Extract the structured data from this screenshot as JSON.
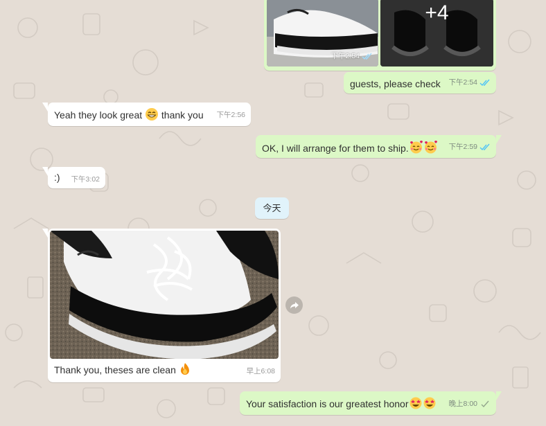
{
  "colors": {
    "outgoing_bubble": "#dcf8c6",
    "incoming_bubble": "#ffffff",
    "wallpaper": "#e5ddd5",
    "date_chip": "#e1f3fb",
    "read_ticks": "#4fc3f7"
  },
  "album": {
    "more_count_label": "+4",
    "time": "下午2:54"
  },
  "messages": [
    {
      "direction": "out",
      "text": "guests, please check",
      "time": "下午2:54",
      "ticks": "read"
    },
    {
      "direction": "in",
      "text": "Yeah they look great",
      "emoji": "beaming-face-emoji",
      "text_after": "thank you",
      "time": "下午2:56"
    },
    {
      "direction": "out",
      "text": "OK, I will arrange for them to ship.",
      "emoji": "smiling-face-with-hearts-emoji x2",
      "time": "下午2:59",
      "ticks": "read"
    },
    {
      "direction": "in",
      "text": ":)",
      "time": "下午3:02"
    },
    {
      "direction": "in",
      "type": "image",
      "caption": "Thank you, theses are clean",
      "emoji": "fire-emoji",
      "time": "早上6:08"
    },
    {
      "direction": "out",
      "text": "Your satisfaction is our greatest honor",
      "emoji": "star-struck-emoji x2",
      "time": "晚上8:00",
      "ticks": "sent"
    }
  ],
  "date_separator": "今天"
}
